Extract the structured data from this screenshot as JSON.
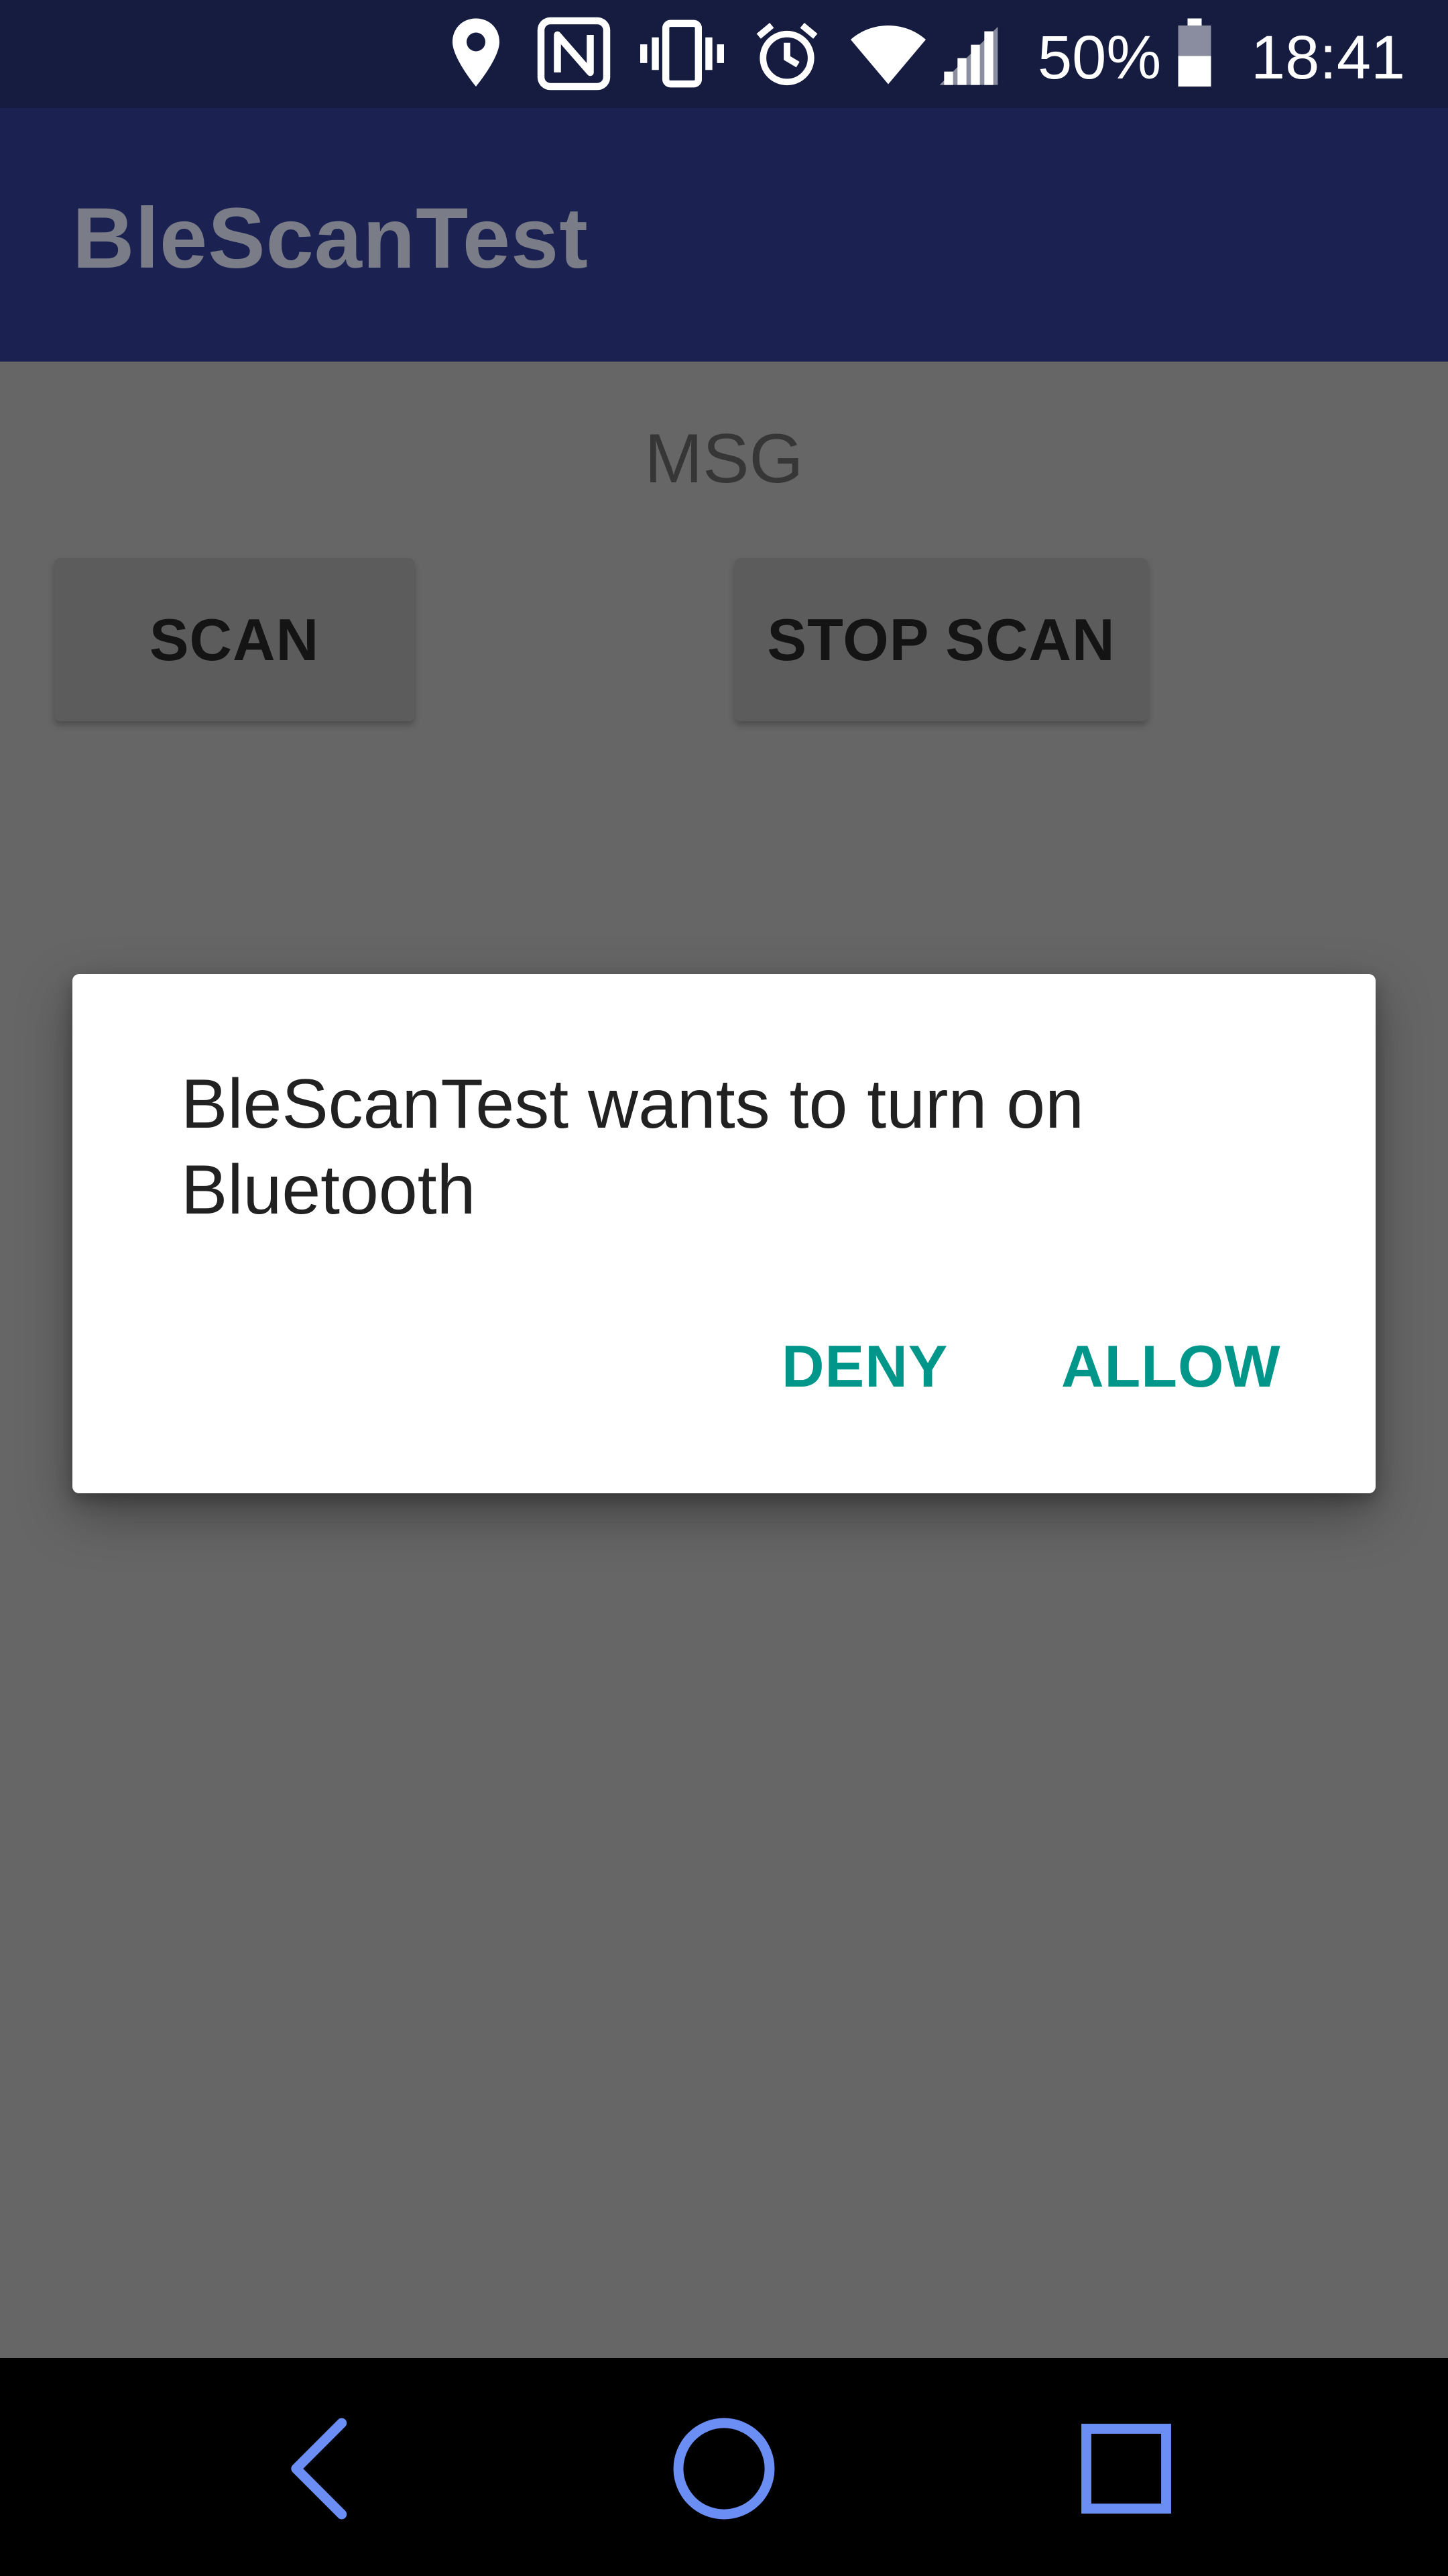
{
  "status_bar": {
    "battery_percent": "50%",
    "time": "18:41",
    "icons": [
      "location-icon",
      "nfc-icon",
      "vibrate-icon",
      "alarm-icon",
      "wifi-icon",
      "cell-signal-icon",
      "battery-icon"
    ]
  },
  "app_bar": {
    "title": "BleScanTest"
  },
  "content": {
    "message": "MSG",
    "scan_label": "SCAN",
    "stop_scan_label": "STOP SCAN"
  },
  "dialog": {
    "message": "BleScanTest wants to turn on Bluetooth",
    "deny_label": "DENY",
    "allow_label": "ALLOW"
  },
  "nav_bar": {
    "icons": [
      "back-icon",
      "home-icon",
      "recents-icon"
    ]
  },
  "colors": {
    "status_bar_bg": "#161c40",
    "app_bar_bg": "#1b2150",
    "scrim": "#666666",
    "dialog_accent": "#00968a",
    "nav_icon": "#6b8ef5"
  }
}
